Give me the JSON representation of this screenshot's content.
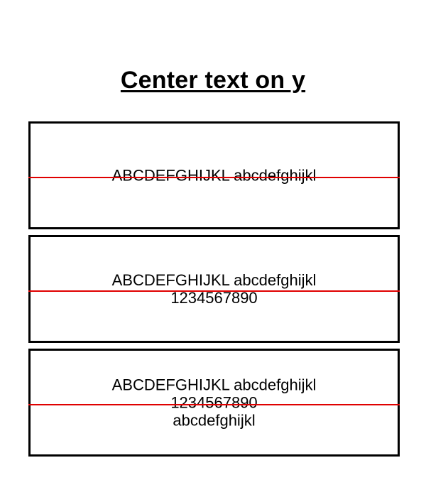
{
  "title": "Center text on y",
  "colors": {
    "guide_line": "#e00000",
    "border": "#000000",
    "background": "#ffffff"
  },
  "boxes": [
    {
      "lines": [
        "ABCDEFGHIJKL abcdefghijkl"
      ]
    },
    {
      "lines": [
        "ABCDEFGHIJKL abcdefghijkl",
        "1234567890"
      ]
    },
    {
      "lines": [
        "ABCDEFGHIJKL abcdefghijkl",
        "1234567890",
        "abcdefghijkl"
      ]
    }
  ]
}
